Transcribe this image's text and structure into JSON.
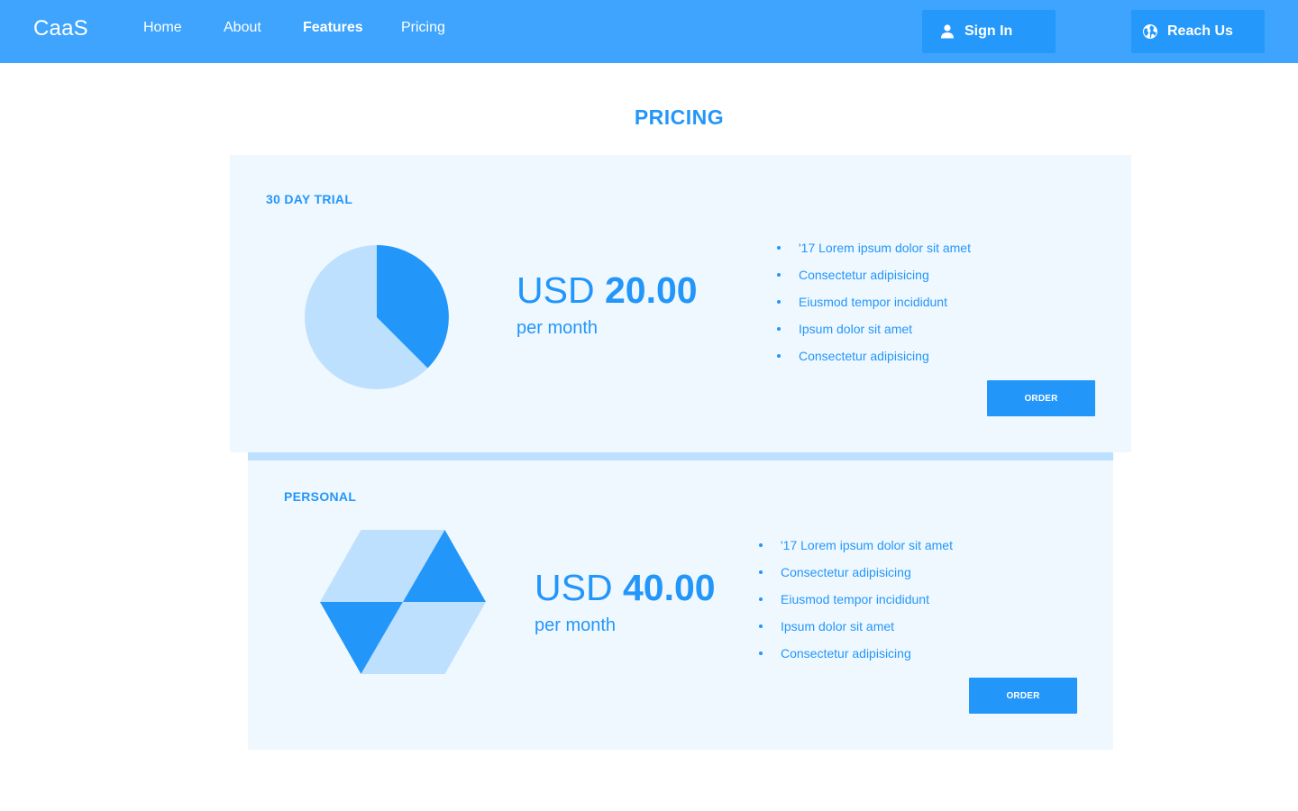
{
  "header": {
    "brand": "CaaS",
    "nav": [
      {
        "label": "Home",
        "active": false
      },
      {
        "label": "About",
        "active": false
      },
      {
        "label": "Features",
        "active": true
      },
      {
        "label": "Pricing",
        "active": false
      }
    ],
    "sign_in_label": "Sign In",
    "sign_in_icon": "user-icon",
    "reach_label": "Reach Us",
    "reach_icon": "globe-icon"
  },
  "main": {
    "title": "PRICING",
    "plans": [
      {
        "name": "30 DAY TRIAL",
        "graphic": "pie-chart-graphic",
        "currency": "USD",
        "amount": "20.00",
        "period": "per month",
        "features": [
          "'17 Lorem ipsum dolor sit amet",
          "Consectetur adipisicing",
          "Eiusmod tempor incididunt",
          "Ipsum dolor sit amet",
          "Consectetur adipisicing"
        ],
        "order_label": "ORDER"
      },
      {
        "name": "PERSONAL",
        "graphic": "hexagon-graphic",
        "currency": "USD",
        "amount": "40.00",
        "period": "per month",
        "features": [
          "'17 Lorem ipsum dolor sit amet",
          "Consectetur adipisicing",
          "Eiusmod tempor incididunt",
          "Ipsum dolor sit amet",
          "Consectetur adipisicing"
        ],
        "order_label": "ORDER"
      }
    ]
  },
  "colors": {
    "header_bg": "#3ea4fd",
    "button_bg": "#2498fb",
    "accent": "#2396fa",
    "card_bg": "#f0f8ff",
    "light_accent": "#bee0ff"
  }
}
